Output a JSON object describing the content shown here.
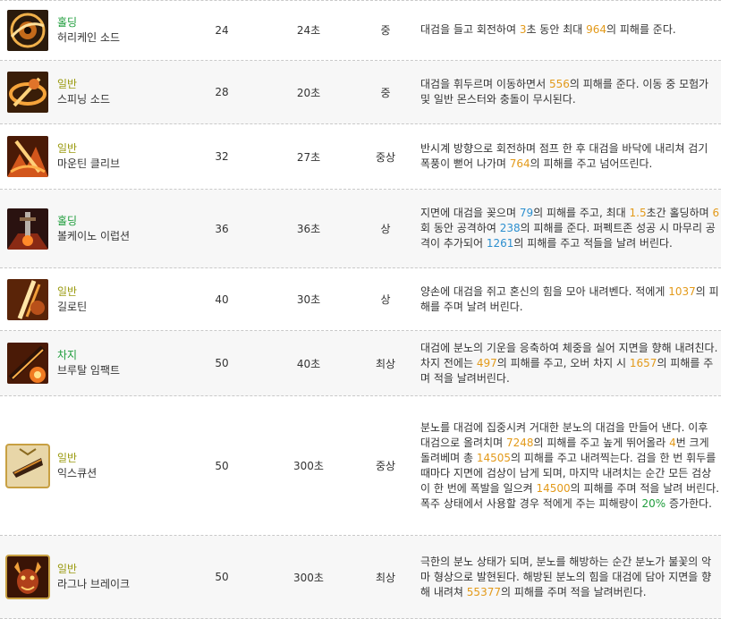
{
  "rows": [
    {
      "icon": "hurricane-sword-icon",
      "type": "홀딩",
      "name": "허리케인 소드",
      "level": "24",
      "cooldown": "24초",
      "mana": "중",
      "desc": [
        {
          "t": "대검을 들고 회전하여 "
        },
        {
          "t": "3",
          "c": "o"
        },
        {
          "t": "초 동안 최대 "
        },
        {
          "t": "964",
          "c": "o"
        },
        {
          "t": "의 피해를 준다."
        }
      ]
    },
    {
      "icon": "spinning-sword-icon",
      "type": "일반",
      "name": "스피닝 소드",
      "level": "28",
      "cooldown": "20초",
      "mana": "중",
      "desc": [
        {
          "t": "대검을 휘두르며 이동하면서 "
        },
        {
          "t": "556",
          "c": "o"
        },
        {
          "t": "의 피해를 준다. 이동 중 모험가 및 일반 몬스터와 충돌이 무시된다."
        }
      ]
    },
    {
      "icon": "mountain-cleave-icon",
      "type": "일반",
      "name": "마운틴 클리브",
      "level": "32",
      "cooldown": "27초",
      "mana": "중상",
      "desc": [
        {
          "t": "반시계 방향으로 회전하며 점프 한 후 대검을 바닥에 내리쳐 검기 폭풍이 뻗어 나가며 "
        },
        {
          "t": "764",
          "c": "o"
        },
        {
          "t": "의 피해를 주고 넘어뜨린다."
        }
      ]
    },
    {
      "icon": "volcano-eruption-icon",
      "type": "홀딩",
      "name": "볼케이노 이럽션",
      "level": "36",
      "cooldown": "36초",
      "mana": "상",
      "desc": [
        {
          "t": "지면에 대검을 꽂으며 "
        },
        {
          "t": "79",
          "c": "b"
        },
        {
          "t": "의 피해를 주고, 최대 "
        },
        {
          "t": "1.5",
          "c": "o"
        },
        {
          "t": "초간 홀딩하며 "
        },
        {
          "t": "6",
          "c": "o"
        },
        {
          "t": "회 동안 공격하여 "
        },
        {
          "t": "238",
          "c": "b"
        },
        {
          "t": "의 피해를 준다. 퍼펙트존 성공 시 마무리 공격이 추가되어 "
        },
        {
          "t": "1261",
          "c": "b"
        },
        {
          "t": "의 피해를 주고 적들을 날려 버린다."
        }
      ]
    },
    {
      "icon": "guillotine-icon",
      "type": "일반",
      "name": "길로틴",
      "level": "40",
      "cooldown": "30초",
      "mana": "상",
      "desc": [
        {
          "t": "양손에 대검을 쥐고 혼신의 힘을 모아 내려벤다. 적에게 "
        },
        {
          "t": "1037",
          "c": "o"
        },
        {
          "t": "의 피해를 주며 날려 버린다."
        }
      ]
    },
    {
      "icon": "brutal-impact-icon",
      "type": "차지",
      "name": "브루탈 임팩트",
      "level": "50",
      "cooldown": "40초",
      "mana": "최상",
      "desc": [
        {
          "t": "대검에 분노의 기운을 응축하여 체중을 실어 지면을 향해 내려친다. 차지 전에는 "
        },
        {
          "t": "497",
          "c": "o"
        },
        {
          "t": "의 피해를 주고, 오버 차지 시 "
        },
        {
          "t": "1657",
          "c": "o"
        },
        {
          "t": "의 피해를 주며 적을 날려버린다."
        }
      ]
    },
    {
      "icon": "execution-icon",
      "type": "일반",
      "name": "익스큐션",
      "level": "50",
      "cooldown": "300초",
      "mana": "중상",
      "desc": [
        {
          "t": "분노를 대검에 집중시켜 거대한 분노의 대검을 만들어 낸다. 이후 대검으로 올려치며 "
        },
        {
          "t": "7248",
          "c": "o"
        },
        {
          "t": "의 피해를 주고 높게 뛰어올라 "
        },
        {
          "t": "4",
          "c": "o"
        },
        {
          "t": "번 크게 돌려베며 총 "
        },
        {
          "t": "14505",
          "c": "o"
        },
        {
          "t": "의 피해를 주고 내려찍는다. 검을 한 번 휘두를 때마다 지면에 검상이 남게 되며, 마지막 내려치는 순간 모든 검상이 한 번에 폭발을 일으켜 "
        },
        {
          "t": "14500",
          "c": "o"
        },
        {
          "t": "의 피해를 주며 적을 날려 버린다. 폭주 상태에서 사용할 경우 적에게 주는 피해량이 "
        },
        {
          "t": "20%",
          "c": "g"
        },
        {
          "t": " 증가한다."
        }
      ]
    },
    {
      "icon": "ragna-break-icon",
      "type": "일반",
      "name": "라그나 브레이크",
      "level": "50",
      "cooldown": "300초",
      "mana": "최상",
      "desc": [
        {
          "t": "극한의 분노 상태가 되며, 분노를 해방하는 순간 분노가 불꽃의 악마 형상으로 발현된다. 해방된 분노의 힘을 대검에 담아 지면을 향해 내려쳐 "
        },
        {
          "t": "55377",
          "c": "o"
        },
        {
          "t": "의 피해를 주며 적을 날려버린다."
        }
      ]
    }
  ],
  "colors": {
    "type_holding": "#1f9d3c",
    "type_normal": "#9a9a10",
    "type_charge": "#1f9d3c",
    "number_orange": "#e39a1a",
    "number_blue": "#2c8fcf",
    "percent_green": "#1f9d3c"
  }
}
